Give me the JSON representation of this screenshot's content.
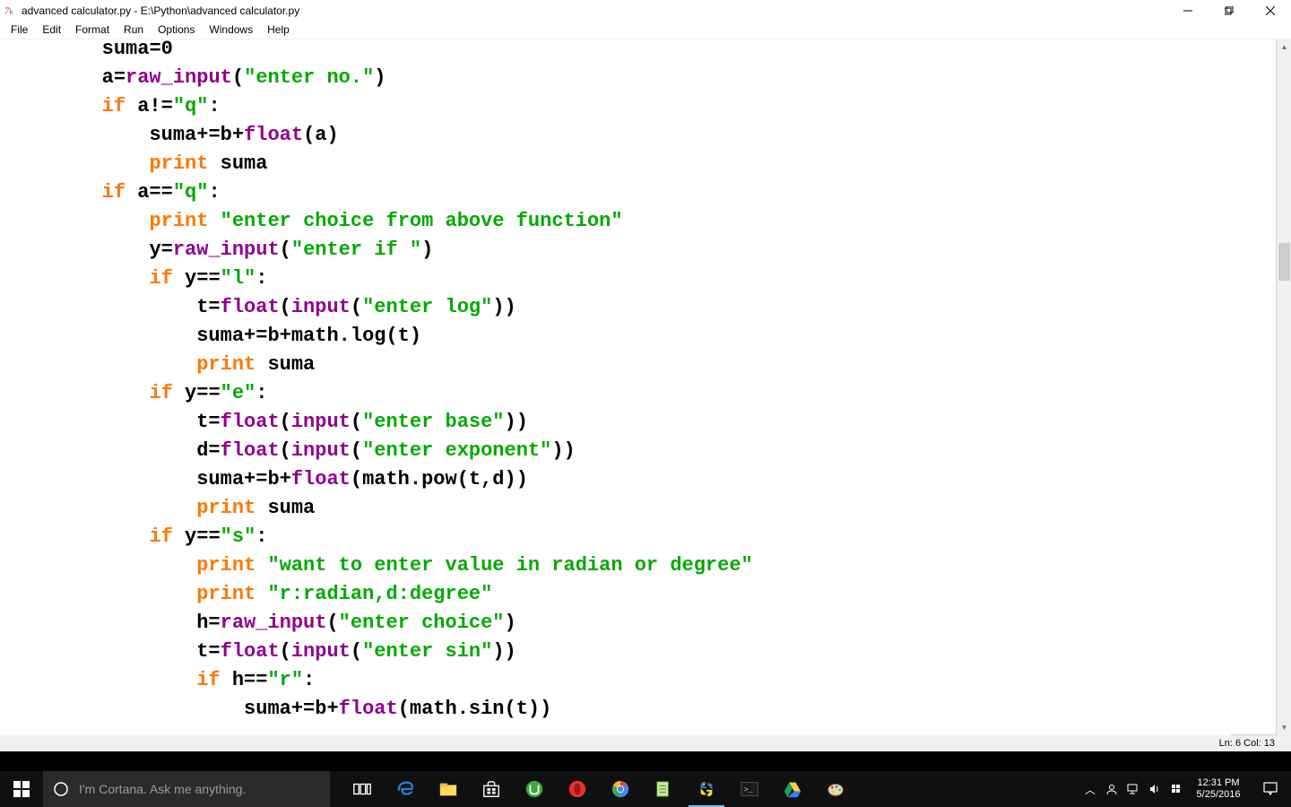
{
  "titlebar": {
    "title": "advanced calculator.py - E:\\Python\\advanced calculator.py"
  },
  "menubar": [
    "File",
    "Edit",
    "Format",
    "Run",
    "Options",
    "Windows",
    "Help"
  ],
  "status": {
    "line": "Ln: 6",
    "col": "Col: 13"
  },
  "taskbar": {
    "cortana_placeholder": "I'm Cortana. Ask me anything.",
    "time": "12:31 PM",
    "date": "5/25/2016"
  },
  "code": {
    "lines": [
      {
        "indent": 8,
        "tokens": [
          {
            "t": "plain",
            "v": "suma"
          },
          {
            "t": "plain",
            "v": "="
          },
          {
            "t": "plain",
            "v": "0"
          }
        ]
      },
      {
        "indent": 8,
        "tokens": [
          {
            "t": "plain",
            "v": "a"
          },
          {
            "t": "plain",
            "v": "="
          },
          {
            "t": "purple",
            "v": "raw_input"
          },
          {
            "t": "plain",
            "v": "("
          },
          {
            "t": "green",
            "v": "\"enter no.\""
          },
          {
            "t": "plain",
            "v": ")"
          }
        ]
      },
      {
        "indent": 8,
        "tokens": [
          {
            "t": "orange",
            "v": "if"
          },
          {
            "t": "plain",
            "v": " a!="
          },
          {
            "t": "green",
            "v": "\"q\""
          },
          {
            "t": "plain",
            "v": ":"
          }
        ]
      },
      {
        "indent": 12,
        "tokens": [
          {
            "t": "plain",
            "v": "suma+=b+"
          },
          {
            "t": "purple",
            "v": "float"
          },
          {
            "t": "plain",
            "v": "(a)"
          }
        ]
      },
      {
        "indent": 12,
        "tokens": [
          {
            "t": "orange",
            "v": "print"
          },
          {
            "t": "plain",
            "v": " suma"
          }
        ]
      },
      {
        "indent": 8,
        "tokens": [
          {
            "t": "orange",
            "v": "if"
          },
          {
            "t": "plain",
            "v": " a=="
          },
          {
            "t": "green",
            "v": "\"q\""
          },
          {
            "t": "plain",
            "v": ":"
          }
        ]
      },
      {
        "indent": 12,
        "tokens": [
          {
            "t": "orange",
            "v": "print"
          },
          {
            "t": "plain",
            "v": " "
          },
          {
            "t": "green",
            "v": "\"enter choice from above function\""
          }
        ]
      },
      {
        "indent": 12,
        "tokens": [
          {
            "t": "plain",
            "v": "y="
          },
          {
            "t": "purple",
            "v": "raw_input"
          },
          {
            "t": "plain",
            "v": "("
          },
          {
            "t": "green",
            "v": "\"enter if \""
          },
          {
            "t": "plain",
            "v": ")"
          }
        ]
      },
      {
        "indent": 12,
        "tokens": [
          {
            "t": "orange",
            "v": "if"
          },
          {
            "t": "plain",
            "v": " y=="
          },
          {
            "t": "green",
            "v": "\"l\""
          },
          {
            "t": "plain",
            "v": ":"
          }
        ]
      },
      {
        "indent": 16,
        "tokens": [
          {
            "t": "plain",
            "v": "t="
          },
          {
            "t": "purple",
            "v": "float"
          },
          {
            "t": "plain",
            "v": "("
          },
          {
            "t": "purple",
            "v": "input"
          },
          {
            "t": "plain",
            "v": "("
          },
          {
            "t": "green",
            "v": "\"enter log\""
          },
          {
            "t": "plain",
            "v": "))"
          }
        ]
      },
      {
        "indent": 16,
        "tokens": [
          {
            "t": "plain",
            "v": "suma+=b+math.log(t)"
          }
        ]
      },
      {
        "indent": 16,
        "tokens": [
          {
            "t": "orange",
            "v": "print"
          },
          {
            "t": "plain",
            "v": " suma"
          }
        ]
      },
      {
        "indent": 12,
        "tokens": [
          {
            "t": "orange",
            "v": "if"
          },
          {
            "t": "plain",
            "v": " y=="
          },
          {
            "t": "green",
            "v": "\"e\""
          },
          {
            "t": "plain",
            "v": ":"
          }
        ]
      },
      {
        "indent": 16,
        "tokens": [
          {
            "t": "plain",
            "v": "t="
          },
          {
            "t": "purple",
            "v": "float"
          },
          {
            "t": "plain",
            "v": "("
          },
          {
            "t": "purple",
            "v": "input"
          },
          {
            "t": "plain",
            "v": "("
          },
          {
            "t": "green",
            "v": "\"enter base\""
          },
          {
            "t": "plain",
            "v": "))"
          }
        ]
      },
      {
        "indent": 16,
        "tokens": [
          {
            "t": "plain",
            "v": "d="
          },
          {
            "t": "purple",
            "v": "float"
          },
          {
            "t": "plain",
            "v": "("
          },
          {
            "t": "purple",
            "v": "input"
          },
          {
            "t": "plain",
            "v": "("
          },
          {
            "t": "green",
            "v": "\"enter exponent\""
          },
          {
            "t": "plain",
            "v": "))"
          }
        ]
      },
      {
        "indent": 16,
        "tokens": [
          {
            "t": "plain",
            "v": "suma+=b+"
          },
          {
            "t": "purple",
            "v": "float"
          },
          {
            "t": "plain",
            "v": "(math.pow(t,d))"
          }
        ]
      },
      {
        "indent": 16,
        "tokens": [
          {
            "t": "orange",
            "v": "print"
          },
          {
            "t": "plain",
            "v": " suma"
          }
        ]
      },
      {
        "indent": 12,
        "tokens": [
          {
            "t": "orange",
            "v": "if"
          },
          {
            "t": "plain",
            "v": " y=="
          },
          {
            "t": "green",
            "v": "\"s\""
          },
          {
            "t": "plain",
            "v": ":"
          }
        ]
      },
      {
        "indent": 16,
        "tokens": [
          {
            "t": "orange",
            "v": "print"
          },
          {
            "t": "plain",
            "v": " "
          },
          {
            "t": "green",
            "v": "\"want to enter value in radian or degree\""
          }
        ]
      },
      {
        "indent": 16,
        "tokens": [
          {
            "t": "orange",
            "v": "print"
          },
          {
            "t": "plain",
            "v": " "
          },
          {
            "t": "green",
            "v": "\"r:radian,d:degree\""
          }
        ]
      },
      {
        "indent": 16,
        "tokens": [
          {
            "t": "plain",
            "v": "h="
          },
          {
            "t": "purple",
            "v": "raw_input"
          },
          {
            "t": "plain",
            "v": "("
          },
          {
            "t": "green",
            "v": "\"enter choice\""
          },
          {
            "t": "plain",
            "v": ")"
          }
        ]
      },
      {
        "indent": 16,
        "tokens": [
          {
            "t": "plain",
            "v": "t="
          },
          {
            "t": "purple",
            "v": "float"
          },
          {
            "t": "plain",
            "v": "("
          },
          {
            "t": "purple",
            "v": "input"
          },
          {
            "t": "plain",
            "v": "("
          },
          {
            "t": "green",
            "v": "\"enter sin\""
          },
          {
            "t": "plain",
            "v": "))"
          }
        ]
      },
      {
        "indent": 16,
        "tokens": [
          {
            "t": "orange",
            "v": "if"
          },
          {
            "t": "plain",
            "v": " h=="
          },
          {
            "t": "green",
            "v": "\"r\""
          },
          {
            "t": "plain",
            "v": ":"
          }
        ]
      },
      {
        "indent": 20,
        "tokens": [
          {
            "t": "plain",
            "v": "suma+=b+"
          },
          {
            "t": "purple",
            "v": "float"
          },
          {
            "t": "plain",
            "v": "(math.sin(t))"
          }
        ]
      }
    ]
  }
}
